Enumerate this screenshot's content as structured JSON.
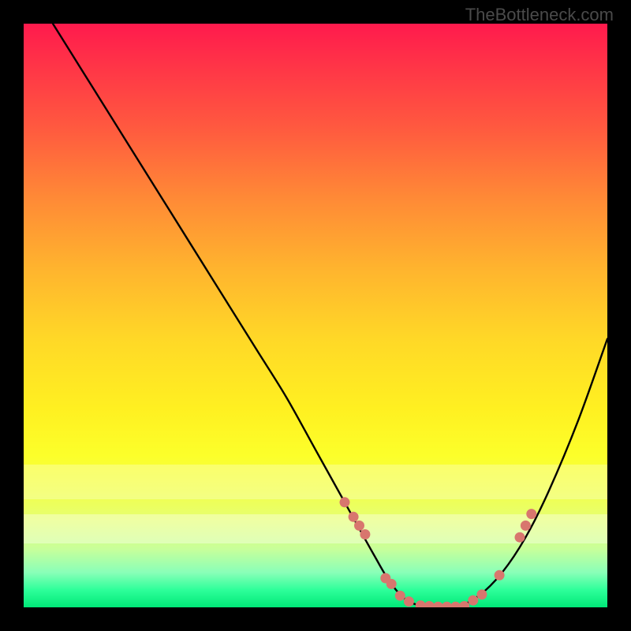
{
  "watermark": "TheBottleneck.com",
  "chart_data": {
    "type": "line",
    "title": "",
    "xlabel": "",
    "ylabel": "",
    "xlim": [
      0,
      100
    ],
    "ylim": [
      0,
      100
    ],
    "series": [
      {
        "name": "curve",
        "x": [
          5,
          10,
          15,
          20,
          25,
          30,
          35,
          40,
          45,
          50,
          55,
          60,
          63,
          66,
          70,
          74,
          78,
          82,
          86,
          90,
          95,
          100
        ],
        "y": [
          100,
          92,
          84,
          76,
          68,
          60,
          52,
          44,
          36,
          27,
          18,
          9,
          4,
          1,
          0,
          0,
          2,
          6,
          12,
          20,
          32,
          46
        ]
      }
    ],
    "markers": {
      "name": "highlighted-points",
      "color": "#d8766e",
      "x": [
        55.0,
        56.5,
        57.5,
        58.5,
        62.0,
        63.0,
        64.5,
        66.0,
        68.0,
        69.5,
        71.0,
        72.5,
        74.0,
        75.5,
        77.0,
        78.5,
        81.5,
        85.0,
        86.0,
        87.0
      ],
      "y": [
        18.0,
        15.5,
        14.0,
        12.5,
        5.0,
        4.0,
        2.0,
        1.0,
        0.3,
        0.2,
        0.1,
        0.1,
        0.1,
        0.2,
        1.2,
        2.2,
        5.5,
        12.0,
        14.0,
        16.0
      ]
    },
    "gradient_bands": [
      {
        "label": "red",
        "from": 0,
        "to": 20
      },
      {
        "label": "orange",
        "from": 20,
        "to": 50
      },
      {
        "label": "yellow",
        "from": 50,
        "to": 80
      },
      {
        "label": "pale-yellow",
        "from": 80,
        "to": 92
      },
      {
        "label": "green",
        "from": 92,
        "to": 100
      }
    ]
  }
}
